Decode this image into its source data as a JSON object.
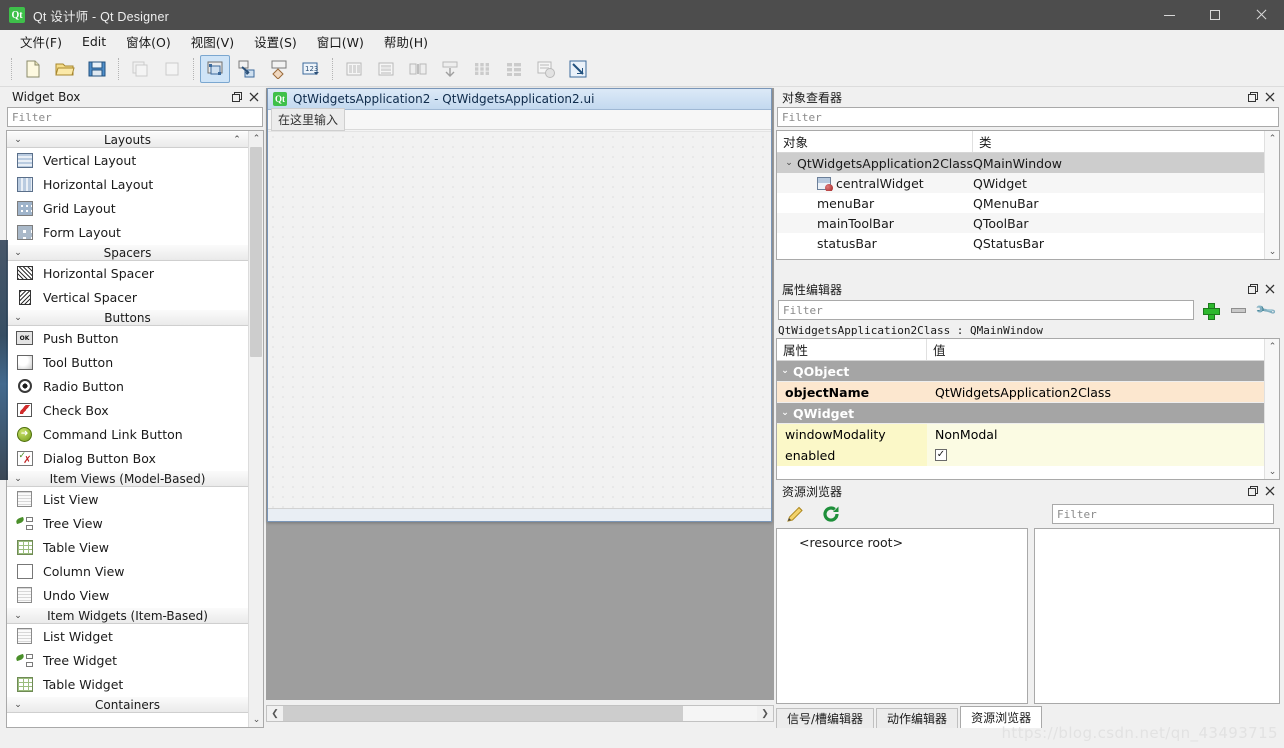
{
  "window": {
    "title": "Qt 设计师 - Qt Designer",
    "icon": "qt-logo-icon",
    "minimize_label": "最小化",
    "maximize_label": "最大化",
    "close_label": "关闭"
  },
  "menubar": {
    "items": [
      {
        "label": "文件(F)",
        "name": "menu-file"
      },
      {
        "label": "Edit",
        "name": "menu-edit"
      },
      {
        "label": "窗体(O)",
        "name": "menu-form"
      },
      {
        "label": "视图(V)",
        "name": "menu-view"
      },
      {
        "label": "设置(S)",
        "name": "menu-settings"
      },
      {
        "label": "窗口(W)",
        "name": "menu-window"
      },
      {
        "label": "帮助(H)",
        "name": "menu-help"
      }
    ]
  },
  "toolbar": {
    "groups": [
      {
        "buttons": [
          {
            "name": "new-form-button",
            "icon": "new-file-icon",
            "state": "normal"
          },
          {
            "name": "open-form-button",
            "icon": "open-folder-icon",
            "state": "normal"
          },
          {
            "name": "save-form-button",
            "icon": "save-disk-icon",
            "state": "normal"
          }
        ]
      },
      {
        "buttons": [
          {
            "name": "undo-button",
            "icon": "undo-icon",
            "state": "disabled"
          },
          {
            "name": "redo-button",
            "icon": "redo-icon",
            "state": "disabled"
          }
        ]
      },
      {
        "buttons": [
          {
            "name": "edit-widgets-button",
            "icon": "edit-widgets-icon",
            "state": "active"
          },
          {
            "name": "edit-signals-slots-button",
            "icon": "signals-slots-icon",
            "state": "normal"
          },
          {
            "name": "edit-buddies-button",
            "icon": "buddies-icon",
            "state": "normal"
          },
          {
            "name": "edit-tab-order-button",
            "icon": "tab-order-icon",
            "state": "normal"
          }
        ]
      },
      {
        "buttons": [
          {
            "name": "layout-horizontally-button",
            "icon": "layout-horizontal-icon",
            "state": "disabled"
          },
          {
            "name": "layout-vertically-button",
            "icon": "layout-vertical-icon",
            "state": "disabled"
          },
          {
            "name": "layout-splitter-horizontal-button",
            "icon": "splitter-horizontal-icon",
            "state": "disabled"
          },
          {
            "name": "layout-splitter-vertical-button",
            "icon": "splitter-vertical-icon",
            "state": "disabled"
          },
          {
            "name": "layout-grid-button",
            "icon": "layout-grid-icon",
            "state": "disabled"
          },
          {
            "name": "layout-form-button",
            "icon": "layout-form-icon",
            "state": "disabled"
          },
          {
            "name": "break-layout-button",
            "icon": "break-layout-icon",
            "state": "disabled"
          },
          {
            "name": "adjust-size-button",
            "icon": "adjust-size-icon",
            "state": "normal"
          }
        ]
      }
    ]
  },
  "widget_box": {
    "title": "Widget Box",
    "filter_placeholder": "Filter",
    "categories": [
      {
        "label": "Layouts",
        "expanded": true,
        "items": [
          {
            "label": "Vertical Layout",
            "icon": "vertical-layout-icon"
          },
          {
            "label": "Horizontal Layout",
            "icon": "horizontal-layout-icon"
          },
          {
            "label": "Grid Layout",
            "icon": "grid-layout-icon"
          },
          {
            "label": "Form Layout",
            "icon": "form-layout-icon"
          }
        ]
      },
      {
        "label": "Spacers",
        "expanded": true,
        "items": [
          {
            "label": "Horizontal Spacer",
            "icon": "horizontal-spacer-icon"
          },
          {
            "label": "Vertical Spacer",
            "icon": "vertical-spacer-icon"
          }
        ]
      },
      {
        "label": "Buttons",
        "expanded": true,
        "items": [
          {
            "label": "Push Button",
            "icon": "push-button-icon"
          },
          {
            "label": "Tool Button",
            "icon": "tool-button-icon"
          },
          {
            "label": "Radio Button",
            "icon": "radio-button-icon"
          },
          {
            "label": "Check Box",
            "icon": "check-box-icon"
          },
          {
            "label": "Command Link Button",
            "icon": "command-link-icon"
          },
          {
            "label": "Dialog Button Box",
            "icon": "dialog-button-box-icon"
          }
        ]
      },
      {
        "label": "Item Views (Model-Based)",
        "expanded": true,
        "items": [
          {
            "label": "List View",
            "icon": "list-view-icon"
          },
          {
            "label": "Tree View",
            "icon": "tree-view-icon"
          },
          {
            "label": "Table View",
            "icon": "table-view-icon"
          },
          {
            "label": "Column View",
            "icon": "column-view-icon"
          },
          {
            "label": "Undo View",
            "icon": "undo-view-icon"
          }
        ]
      },
      {
        "label": "Item Widgets (Item-Based)",
        "expanded": true,
        "items": [
          {
            "label": "List Widget",
            "icon": "list-widget-icon"
          },
          {
            "label": "Tree Widget",
            "icon": "tree-widget-icon"
          },
          {
            "label": "Table Widget",
            "icon": "table-widget-icon"
          }
        ]
      },
      {
        "label": "Containers",
        "expanded": true,
        "items": []
      }
    ]
  },
  "form_editor": {
    "window_title": "QtWidgetsApplication2 - QtWidgetsApplication2.ui",
    "icon": "qt-form-icon",
    "menu_placeholder": "在这里输入",
    "scroll": {
      "h_left": "◀",
      "h_right": "▶"
    }
  },
  "object_inspector": {
    "title": "对象查看器",
    "filter_placeholder": "Filter",
    "columns": [
      "对象",
      "类"
    ],
    "rows": [
      {
        "object": "QtWidgetsApplication2Class",
        "class": "QMainWindow",
        "depth": 0,
        "expanded": true,
        "selected": true,
        "icon": ""
      },
      {
        "object": "centralWidget",
        "class": "QWidget",
        "depth": 1,
        "expanded": false,
        "selected": false,
        "icon": "central-widget-icon"
      },
      {
        "object": "menuBar",
        "class": "QMenuBar",
        "depth": 1,
        "expanded": false,
        "selected": false,
        "icon": ""
      },
      {
        "object": "mainToolBar",
        "class": "QToolBar",
        "depth": 1,
        "expanded": false,
        "selected": false,
        "icon": ""
      },
      {
        "object": "statusBar",
        "class": "QStatusBar",
        "depth": 1,
        "expanded": false,
        "selected": false,
        "icon": ""
      }
    ]
  },
  "property_editor": {
    "title": "属性编辑器",
    "filter_placeholder": "Filter",
    "object_line": "QtWidgetsApplication2Class : QMainWindow",
    "columns": [
      "属性",
      "值"
    ],
    "add_button": "add-property-button",
    "remove_button": "remove-property-button",
    "configure_button": "configure-button",
    "rows": [
      {
        "kind": "group",
        "name": "QObject",
        "value": "",
        "expanded": true
      },
      {
        "kind": "highlight",
        "name": "objectName",
        "value": "QtWidgetsApplication2Class"
      },
      {
        "kind": "group",
        "name": "QWidget",
        "value": "",
        "expanded": true
      },
      {
        "kind": "yellow",
        "name": "windowModality",
        "value": "NonModal"
      },
      {
        "kind": "yellow-check",
        "name": "enabled",
        "value": "✓"
      }
    ]
  },
  "resource_browser": {
    "title": "资源浏览器",
    "edit_button": "edit-resources-button",
    "reload_button": "reload-resources-button",
    "filter_placeholder": "Filter",
    "root_label": "<resource root>",
    "tabs": [
      {
        "label": "信号/槽编辑器",
        "active": false
      },
      {
        "label": "动作编辑器",
        "active": false
      },
      {
        "label": "资源浏览器",
        "active": true
      }
    ]
  },
  "watermark": "https://blog.csdn.net/qn_43493715",
  "colors": {
    "titlebar_bg": "#4d4d4d",
    "chrome_bg": "#f0f0f0",
    "mdi_bg": "#9e9e9e",
    "selection": "#cdcdcd",
    "property_highlight": "#fce7cf",
    "property_yellow": "#fbf8c8",
    "group_header": "#a5a5a5",
    "accent_green": "#3ec04a"
  }
}
